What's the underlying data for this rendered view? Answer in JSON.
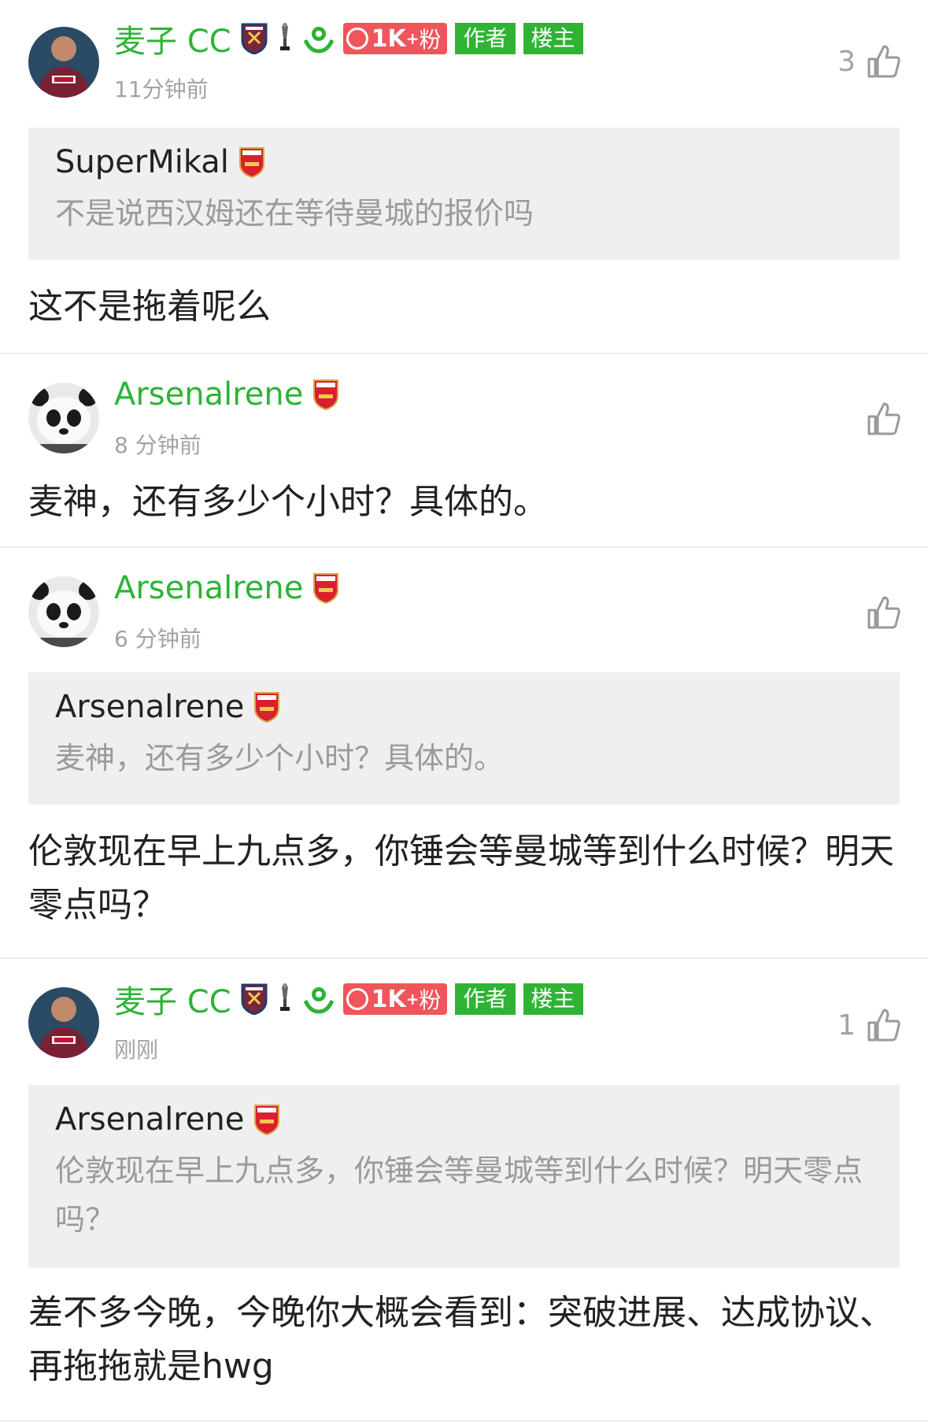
{
  "comments": [
    {
      "username": "麦子 CC",
      "time": "11分钟前",
      "likes": "3",
      "tag_author": "作者",
      "tag_op": "楼主",
      "fans_value": "1K",
      "fans_plus": "+",
      "fans_unit": "粉",
      "quote": {
        "name": "SuperMikal",
        "text": "不是说西汉姆还在等待曼城的报价吗"
      },
      "body": "这不是拖着呢么"
    },
    {
      "username": "Arsenalrene",
      "time": "8 分钟前",
      "likes": "",
      "body": "麦神，还有多少个小时？具体的。"
    },
    {
      "username": "Arsenalrene",
      "time": "6 分钟前",
      "likes": "",
      "quote": {
        "name": "Arsenalrene",
        "text": "麦神，还有多少个小时？具体的。"
      },
      "body": "伦敦现在早上九点多，你锤会等曼城等到什么时候？明天零点吗？"
    },
    {
      "username": "麦子 CC",
      "time": "刚刚",
      "likes": "1",
      "tag_author": "作者",
      "tag_op": "楼主",
      "fans_value": "1K",
      "fans_plus": "+",
      "fans_unit": "粉",
      "quote": {
        "name": "Arsenalrene",
        "text": "伦敦现在早上九点多，你锤会等曼城等到什么时候？明天零点吗？"
      },
      "body": "差不多今晚，今晚你大概会看到：突破进展、达成协议、再拖拖就是hwg"
    }
  ],
  "colors": {
    "username": "#2db336",
    "tag_bg": "#30b335",
    "fans_bg": "#f0555b",
    "quote_bg": "#efefef",
    "divider": "#ececec"
  },
  "icons": {
    "like": "thumbs-up-icon",
    "west_ham": "west-ham-crest-icon",
    "arsenal": "arsenal-crest-icon",
    "trophy": "trophy-icon",
    "badge": "green-hand-badge-icon",
    "fans": "user-circle-icon"
  }
}
